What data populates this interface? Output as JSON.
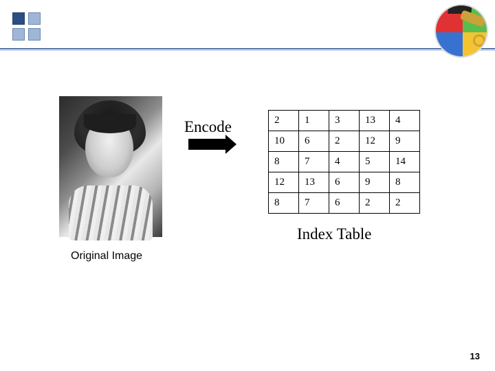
{
  "labels": {
    "encode": "Encode",
    "index_table": "Index Table",
    "original_image": "Original Image"
  },
  "chart_data": {
    "type": "table",
    "title": "Index Table",
    "rows": [
      [
        2,
        1,
        3,
        13,
        4
      ],
      [
        10,
        6,
        2,
        12,
        9
      ],
      [
        8,
        7,
        4,
        5,
        14
      ],
      [
        12,
        13,
        6,
        9,
        8
      ],
      [
        8,
        7,
        6,
        2,
        2
      ]
    ]
  },
  "page_number": "13"
}
